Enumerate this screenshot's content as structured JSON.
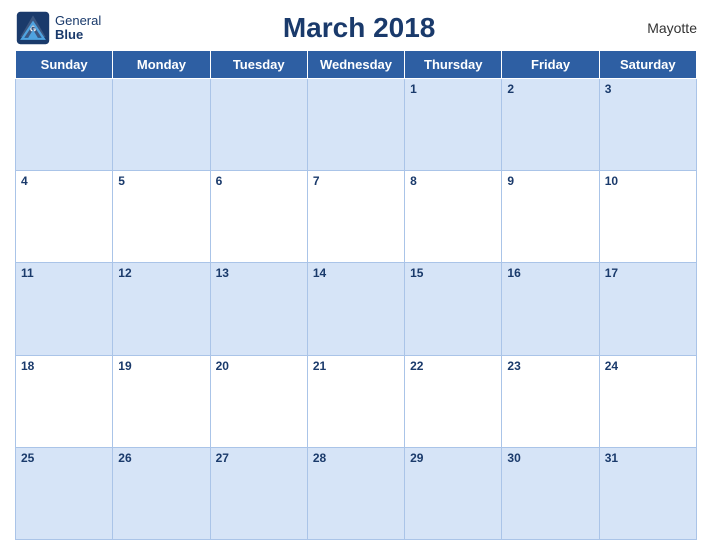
{
  "header": {
    "logo_line1": "General",
    "logo_line2": "Blue",
    "title": "March 2018",
    "region": "Mayotte"
  },
  "days_of_week": [
    "Sunday",
    "Monday",
    "Tuesday",
    "Wednesday",
    "Thursday",
    "Friday",
    "Saturday"
  ],
  "weeks": [
    [
      "",
      "",
      "",
      "",
      "1",
      "2",
      "3"
    ],
    [
      "4",
      "5",
      "6",
      "7",
      "8",
      "9",
      "10"
    ],
    [
      "11",
      "12",
      "13",
      "14",
      "15",
      "16",
      "17"
    ],
    [
      "18",
      "19",
      "20",
      "21",
      "22",
      "23",
      "24"
    ],
    [
      "25",
      "26",
      "27",
      "28",
      "29",
      "30",
      "31"
    ]
  ]
}
